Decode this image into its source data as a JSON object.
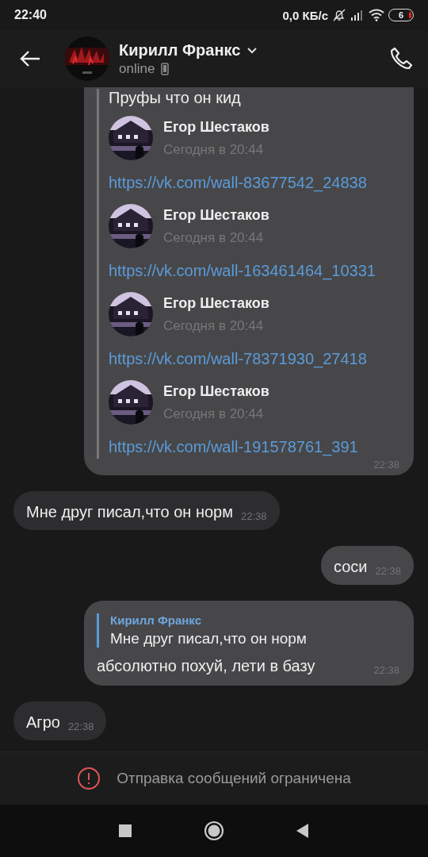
{
  "status_bar": {
    "time": "22:40",
    "network_speed": "0,0 КБ/с",
    "battery": "6"
  },
  "header": {
    "name": "Кирилл Франкс",
    "status": "online"
  },
  "messages": [
    {
      "kind": "forward",
      "outgoing": true,
      "quote": "Пруфы что он кид",
      "time": "22:38",
      "posts": [
        {
          "author": "Егор Шестаков",
          "date": "Сегодня в 20:44",
          "link": "https://vk.com/wall-83677542_24838"
        },
        {
          "author": "Егор Шестаков",
          "date": "Сегодня в 20:44",
          "link": "https://vk.com/wall-163461464_10331"
        },
        {
          "author": "Егор Шестаков",
          "date": "Сегодня в 20:44",
          "link": "https://vk.com/wall-78371930_27418"
        },
        {
          "author": "Егор Шестаков",
          "date": "Сегодня в 20:44",
          "link": "https://vk.com/wall-191578761_391"
        }
      ]
    },
    {
      "kind": "text",
      "outgoing": false,
      "text": "Мне друг писал,что он норм",
      "time": "22:38"
    },
    {
      "kind": "text",
      "outgoing": true,
      "text": "соси",
      "time": "22:38"
    },
    {
      "kind": "reply",
      "outgoing": true,
      "reply_author": "Кирилл Франкс",
      "reply_text": "Мне друг писал,что он норм",
      "text": "абсолютно похуй, лети в базу",
      "time": "22:38"
    },
    {
      "kind": "text",
      "outgoing": false,
      "text": "Агро",
      "time": "22:38"
    }
  ],
  "notice": "Отправка сообщений ограничена"
}
